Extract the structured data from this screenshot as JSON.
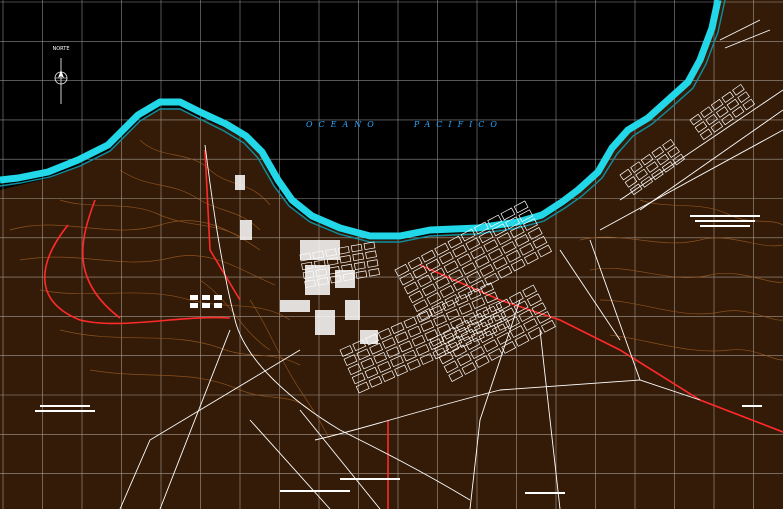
{
  "map": {
    "ocean_label": {
      "word1": "OCEANO",
      "word2": "PACIFICO"
    },
    "north_label": "NORTE"
  },
  "colors": {
    "background": "#000000",
    "grid": "#ffffff",
    "coast": "#22d7e8",
    "topo": "#8a4a1c",
    "roads": "#ffffff",
    "main_road": "#ff2a2a",
    "ocean_text": "#2aa7ff"
  }
}
